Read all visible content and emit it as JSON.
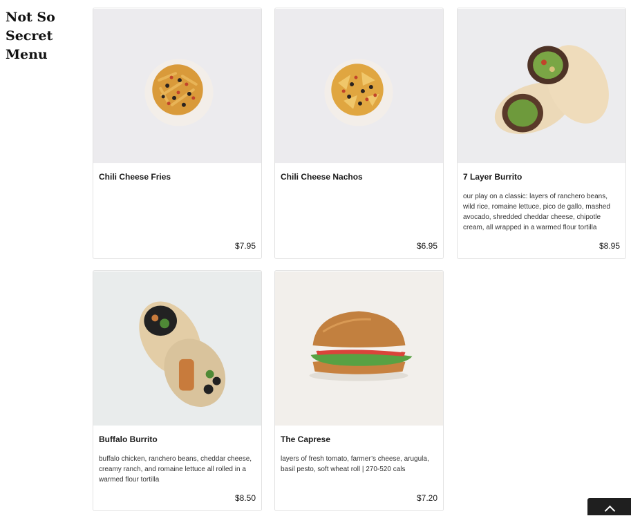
{
  "section": {
    "title": "Not So Secret Menu"
  },
  "items": [
    {
      "name": "Chili Cheese Fries",
      "description": "",
      "price": "$7.95",
      "image": "plate-fries"
    },
    {
      "name": "Chili Cheese Nachos",
      "description": "",
      "price": "$6.95",
      "image": "plate-nachos"
    },
    {
      "name": "7 Layer Burrito",
      "description": "our play on a classic: layers of ranchero beans, wild rice, romaine lettuce, pico de gallo, mashed avocado, shredded cheddar cheese, chipotle cream, all wrapped in a warmed flour tortilla",
      "price": "$8.95",
      "image": "burrito-halves"
    },
    {
      "name": "Buffalo Burrito",
      "description": "buffalo chicken, ranchero beans, cheddar cheese, creamy ranch, and romaine lettuce all rolled in a warmed flour tortilla",
      "price": "$8.50",
      "image": "burrito-halves"
    },
    {
      "name": "The Caprese",
      "description": "layers of fresh tomato, farmer’s cheese, arugula, basil pesto, soft wheat roll | 270-520 cals",
      "price": "$7.20",
      "image": "sandwich"
    }
  ],
  "scroll_top": {
    "icon": "chevron-up-icon"
  }
}
